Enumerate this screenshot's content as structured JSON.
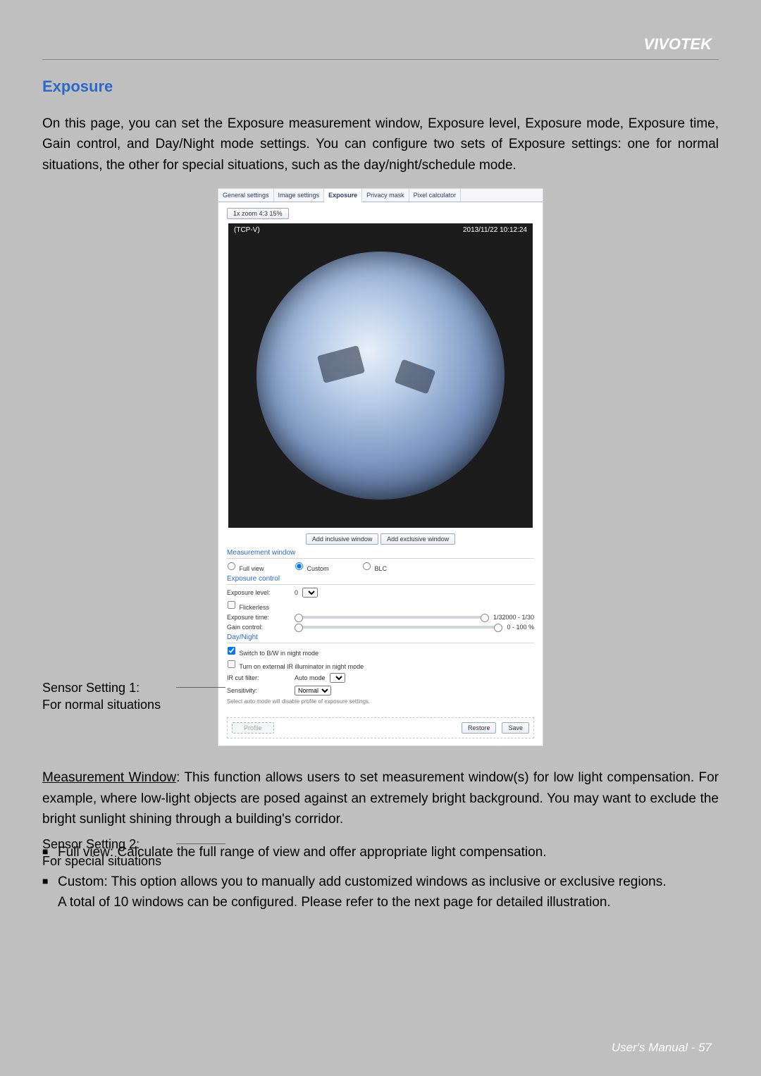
{
  "brand": "VIVOTEK",
  "section_title": "Exposure",
  "intro": "On this page, you can set the Exposure measurement window, Exposure level, Exposure mode, Exposure time, Gain control, and Day/Night mode settings. You can configure two sets of Exposure settings: one for normal situations, the other for special situations, such as the day/night/schedule mode.",
  "side_labels": {
    "label1_line1": "Sensor Setting 1:",
    "label1_line2": "For normal situations",
    "label2_line1": "Sensor Setting 2:",
    "label2_line2": "For special situations"
  },
  "panel": {
    "tabs": {
      "general": "General settings",
      "image": "Image settings",
      "exposure": "Exposure",
      "privacy": "Privacy mask",
      "pixel": "Pixel calculator"
    },
    "zoom_btn": "1x zoom 4:3 15%",
    "tcpv": "(TCP-V)",
    "timestamp": "2013/11/22 10:12:24",
    "add_inclusive": "Add inclusive window",
    "add_exclusive": "Add exclusive window",
    "measurement_title": "Measurement window",
    "radios": {
      "full": "Full view",
      "custom": "Custom",
      "blc": "BLC"
    },
    "exposure_title": "Exposure control",
    "exposure_level_label": "Exposure level:",
    "exposure_level_value": "0",
    "flickerless": "Flickerless",
    "exposure_time_label": "Exposure time:",
    "exposure_time_value": "1/32000 - 1/30",
    "gain_label": "Gain control:",
    "gain_value": "0 - 100 %",
    "daynight_title": "Day/Night",
    "switch_bw": "Switch to B/W in night mode",
    "ir_illum": "Turn on external IR illuminator in night mode",
    "ir_cut_label": "IR cut filter:",
    "ir_cut_value": "Auto mode",
    "sensitivity_label": "Sensitivity:",
    "sensitivity_value": "Normal",
    "auto_note": "Select auto mode will disable profile of exposure settings.",
    "profile_btn": "Profile",
    "restore_btn": "Restore",
    "save_btn": "Save"
  },
  "measurement_para_lead": "Measurement Window",
  "measurement_para_rest": ": This function allows users to set measurement window(s) for low light compensation. For example, where low-light objects are posed against an extremely bright background. You may want to exclude the bright sunlight shining through a building's corridor.",
  "bullets": {
    "b1": "Full view: Calculate the full range of view and offer appropriate light compensation.",
    "b2a": "Custom: This option allows you to manually add customized windows as inclusive or exclusive regions.",
    "b2b": "A total of 10 windows can be configured. Please refer to the next page for detailed illustration."
  },
  "footer": "User's Manual - 57"
}
